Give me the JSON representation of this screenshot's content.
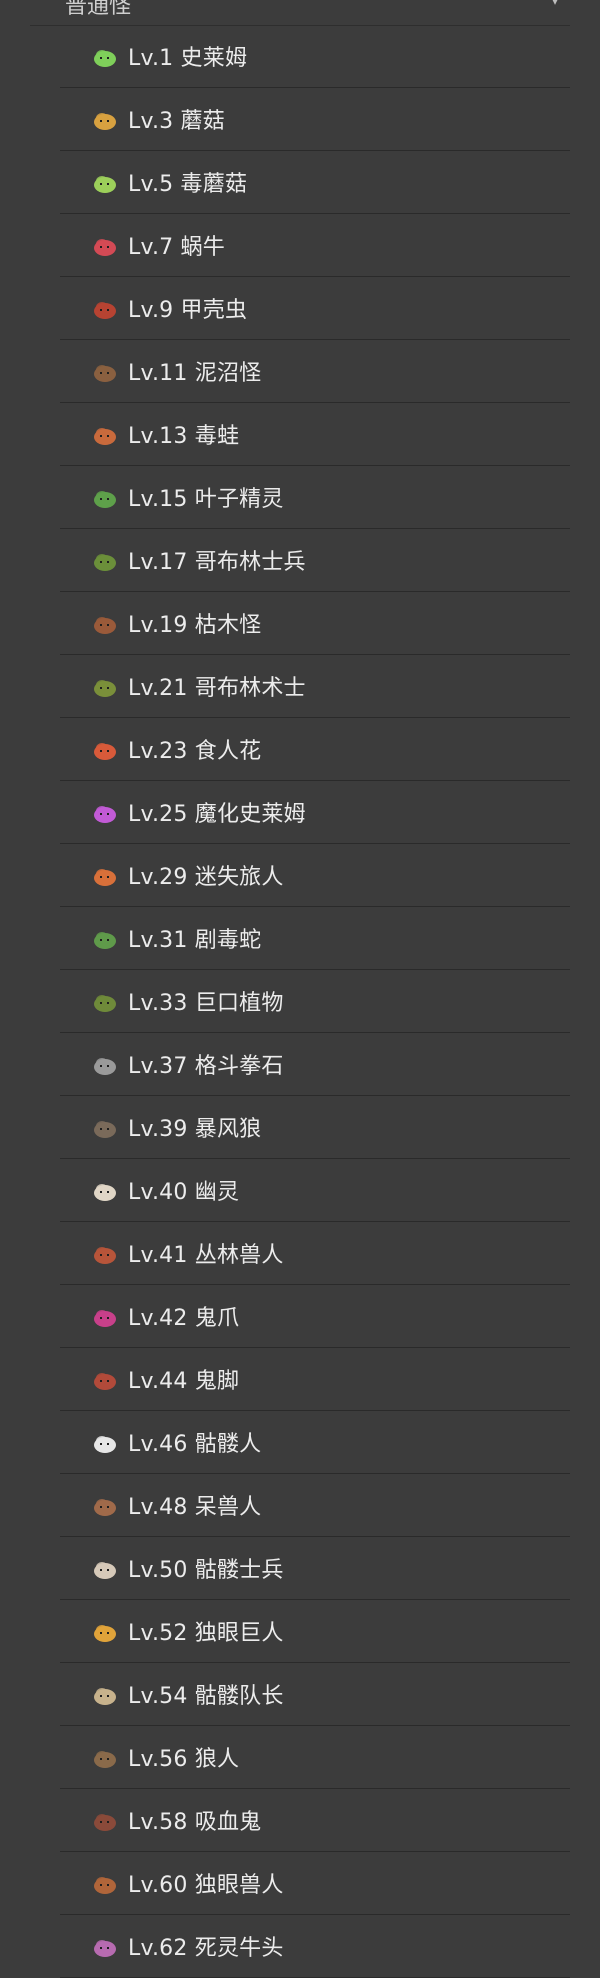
{
  "section": {
    "title": "普通怪",
    "chevron_icon": "chevron-down-icon"
  },
  "monsters": [
    {
      "label": "Lv.1 史莱姆",
      "icon": "slime-icon",
      "color": "#7fcf5a"
    },
    {
      "label": "Lv.3 蘑菇",
      "icon": "mushroom-icon",
      "color": "#d8a140"
    },
    {
      "label": "Lv.5 毒蘑菇",
      "icon": "poison-mushroom-icon",
      "color": "#9ccf5a"
    },
    {
      "label": "Lv.7 蜗牛",
      "icon": "snail-icon",
      "color": "#d34a55"
    },
    {
      "label": "Lv.9 甲壳虫",
      "icon": "beetle-icon",
      "color": "#b74332"
    },
    {
      "label": "Lv.11 泥沼怪",
      "icon": "swamp-monster-icon",
      "color": "#8a6040"
    },
    {
      "label": "Lv.13 毒蛙",
      "icon": "poison-frog-icon",
      "color": "#c96a3c"
    },
    {
      "label": "Lv.15 叶子精灵",
      "icon": "leaf-sprite-icon",
      "color": "#5ea04a"
    },
    {
      "label": "Lv.17 哥布林士兵",
      "icon": "goblin-soldier-icon",
      "color": "#6b8f3a"
    },
    {
      "label": "Lv.19 枯木怪",
      "icon": "deadwood-monster-icon",
      "color": "#9a5a3a"
    },
    {
      "label": "Lv.21 哥布林术士",
      "icon": "goblin-mage-icon",
      "color": "#7a8f3a"
    },
    {
      "label": "Lv.23 食人花",
      "icon": "man-eating-flower-icon",
      "color": "#d85a3a"
    },
    {
      "label": "Lv.25 魔化史莱姆",
      "icon": "demon-slime-icon",
      "color": "#c25bd6"
    },
    {
      "label": "Lv.29 迷失旅人",
      "icon": "lost-traveler-icon",
      "color": "#d8703a"
    },
    {
      "label": "Lv.31 剧毒蛇",
      "icon": "venom-snake-icon",
      "color": "#5f9a4a"
    },
    {
      "label": "Lv.33 巨口植物",
      "icon": "big-mouth-plant-icon",
      "color": "#6f8a3a"
    },
    {
      "label": "Lv.37 格斗拳石",
      "icon": "fighting-rock-icon",
      "color": "#9a9a9a"
    },
    {
      "label": "Lv.39 暴风狼",
      "icon": "storm-wolf-icon",
      "color": "#7a6a5a"
    },
    {
      "label": "Lv.40 幽灵",
      "icon": "ghost-icon",
      "color": "#e0d6c6"
    },
    {
      "label": "Lv.41 丛林兽人",
      "icon": "jungle-orc-icon",
      "color": "#b7553a"
    },
    {
      "label": "Lv.42 鬼爪",
      "icon": "ghost-claw-icon",
      "color": "#c8408a"
    },
    {
      "label": "Lv.44 鬼脚",
      "icon": "ghost-foot-icon",
      "color": "#b24a3a"
    },
    {
      "label": "Lv.46 骷髅人",
      "icon": "skeleton-icon",
      "color": "#e6e6e6"
    },
    {
      "label": "Lv.48 呆兽人",
      "icon": "dull-orc-icon",
      "color": "#a06a4a"
    },
    {
      "label": "Lv.50 骷髅士兵",
      "icon": "skeleton-soldier-icon",
      "color": "#d6c9b9"
    },
    {
      "label": "Lv.52 独眼巨人",
      "icon": "cyclops-icon",
      "color": "#e0a33a"
    },
    {
      "label": "Lv.54 骷髅队长",
      "icon": "skeleton-captain-icon",
      "color": "#c7b28c"
    },
    {
      "label": "Lv.56 狼人",
      "icon": "werewolf-icon",
      "color": "#8a6a4a"
    },
    {
      "label": "Lv.58 吸血鬼",
      "icon": "vampire-icon",
      "color": "#8a4a3a"
    },
    {
      "label": "Lv.60 独眼兽人",
      "icon": "cyclops-orc-icon",
      "color": "#b0653a"
    },
    {
      "label": "Lv.62 死灵牛头",
      "icon": "undead-minotaur-icon",
      "color": "#b76bb0"
    }
  ]
}
